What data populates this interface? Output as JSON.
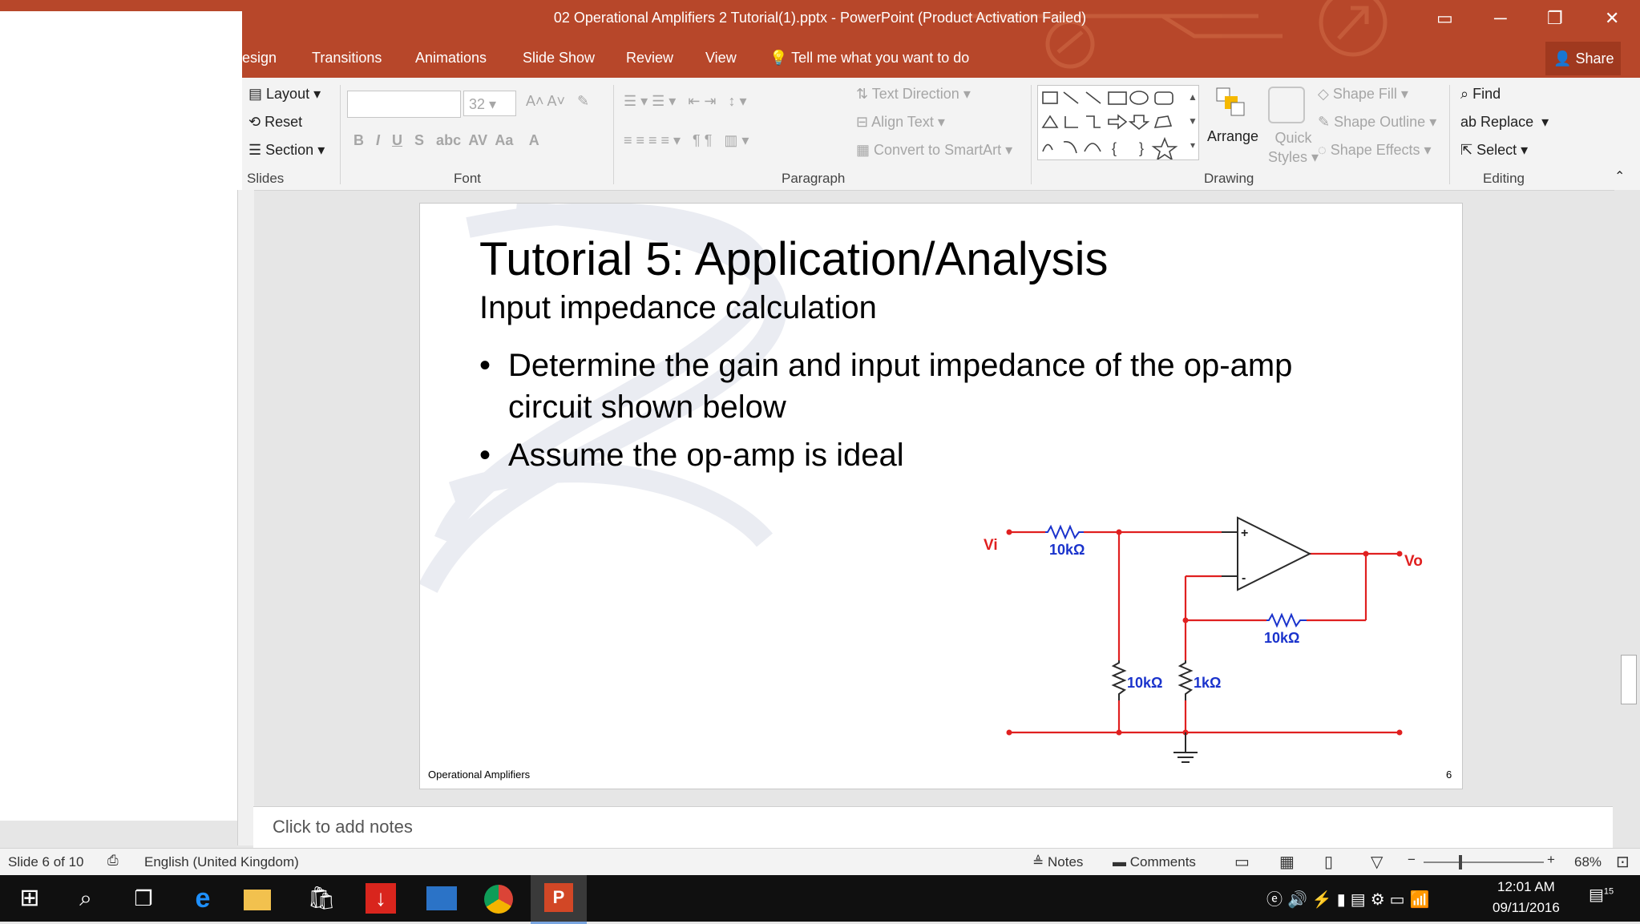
{
  "window": {
    "title": "02 Operational Amplifiers 2 Tutorial(1).pptx - PowerPoint (Product Activation Failed)"
  },
  "tabs": [
    "esign",
    "Transitions",
    "Animations",
    "Slide Show",
    "Review",
    "View"
  ],
  "tell_me": "Tell me what you want to do",
  "share": "Share",
  "ribbon": {
    "slides": {
      "layout": "Layout",
      "reset": "Reset",
      "section": "Section",
      "group": "Slides"
    },
    "font": {
      "size": "32",
      "group": "Font"
    },
    "paragraph": {
      "text_direction": "Text Direction",
      "align_text": "Align Text",
      "convert_smartart": "Convert to SmartArt",
      "group": "Paragraph"
    },
    "drawing": {
      "arrange": "Arrange",
      "quick": "Quick",
      "styles": "Styles",
      "shape_fill": "Shape Fill",
      "shape_outline": "Shape Outline",
      "shape_effects": "Shape Effects",
      "group": "Drawing"
    },
    "editing": {
      "find": "Find",
      "replace": "Replace",
      "select": "Select",
      "group": "Editing"
    }
  },
  "slide": {
    "title": "Tutorial 5: Application/Analysis",
    "subtitle": "Input impedance calculation",
    "bullet1_line1": "Determine the gain and input impedance of the op-amp",
    "bullet1_line2": "circuit shown below",
    "bullet2": "Assume the op-amp is ideal",
    "footer": "Operational Amplifiers",
    "number": "6",
    "circuit": {
      "vi": "Vi",
      "vo": "Vo",
      "r_in": "10kΩ",
      "r_f": "10kΩ",
      "r_shunt": "10kΩ",
      "r_gnd": "1kΩ",
      "plus": "+",
      "minus": "-"
    }
  },
  "notes_placeholder": "Click to add notes",
  "status": {
    "slide": "Slide 6 of 10",
    "language": "English (United Kingdom)",
    "notes": "Notes",
    "comments": "Comments",
    "zoom": "68%"
  },
  "taskbar": {
    "time": "12:01 AM",
    "date": "09/11/2016",
    "notifications": "15"
  },
  "colors": {
    "accent": "#b7472a",
    "circuit_wire": "#e02020",
    "resistor_label": "#1a33cc"
  }
}
